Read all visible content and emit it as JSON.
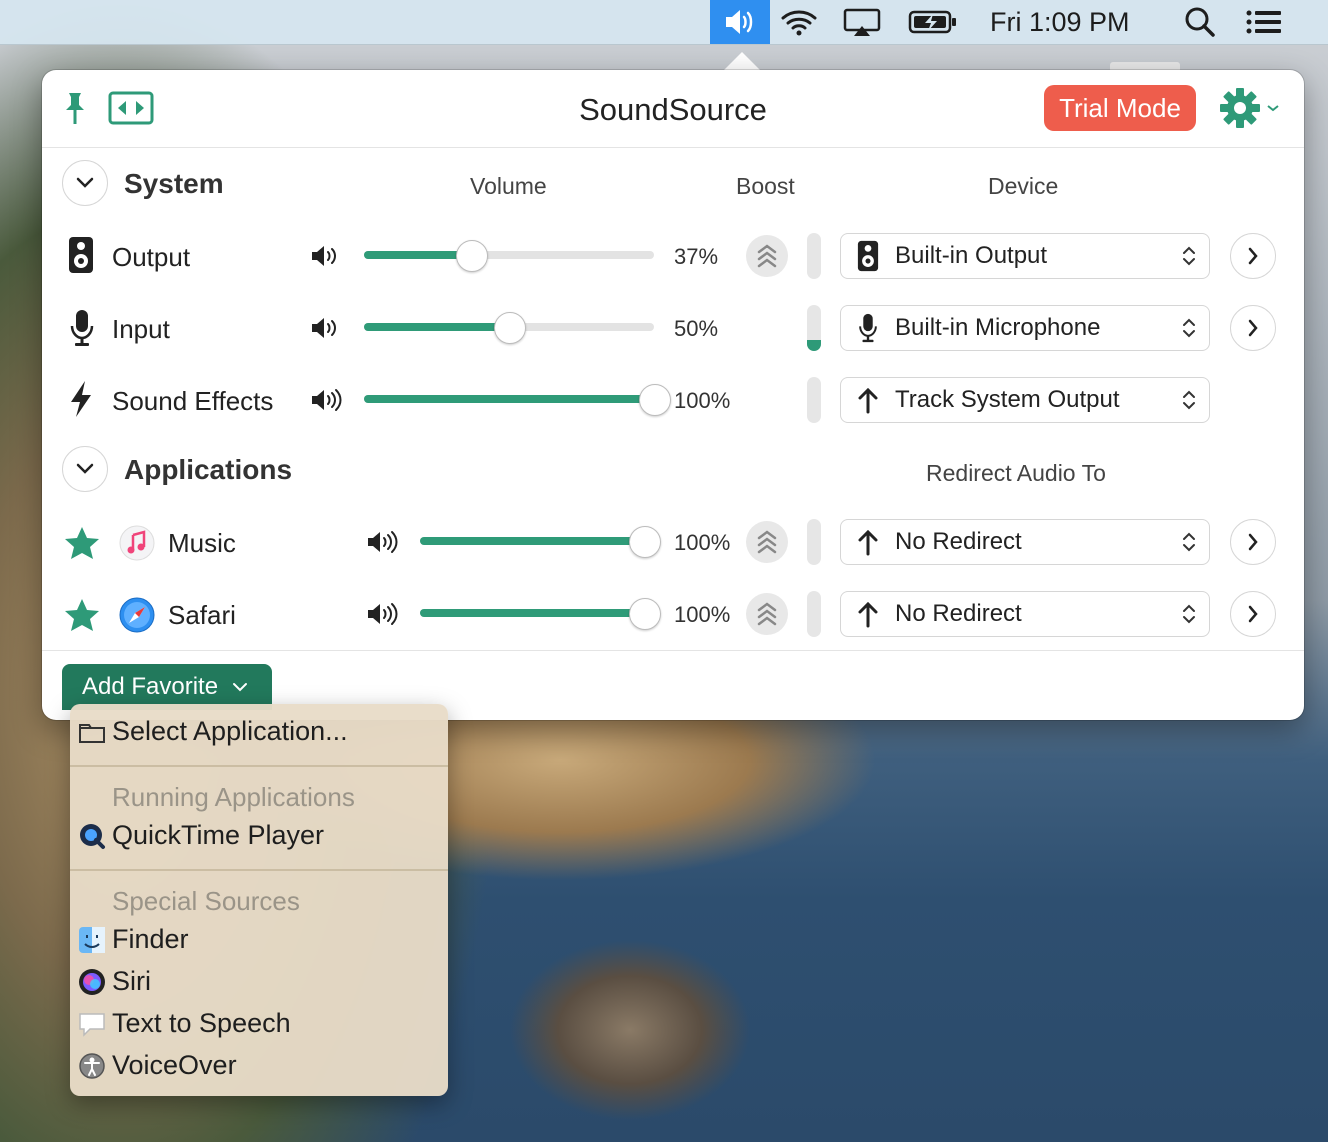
{
  "menubar": {
    "clock": "Fri 1:09 PM",
    "icons": [
      "sound-icon",
      "wifi-icon",
      "airplay-icon",
      "battery-charging-icon",
      "spotlight-search-icon",
      "control-center-icon"
    ]
  },
  "panel": {
    "title": "SoundSource",
    "trial_label": "Trial Mode",
    "accent_color": "#2e9a78",
    "trial_color": "#ee5d4c"
  },
  "system": {
    "title": "System",
    "col_volume": "Volume",
    "col_boost": "Boost",
    "col_device": "Device",
    "rows": [
      {
        "label": "Output",
        "volume": 37,
        "pct": "37%",
        "device": "Built-in Output",
        "meter": 0
      },
      {
        "label": "Input",
        "volume": 50,
        "pct": "50%",
        "device": "Built-in Microphone",
        "meter": 0.25
      },
      {
        "label": "Sound Effects",
        "volume": 100,
        "pct": "100%",
        "device": "Track System Output",
        "meter": 0
      }
    ]
  },
  "applications": {
    "title": "Applications",
    "col_redirect": "Redirect Audio To",
    "rows": [
      {
        "label": "Music",
        "volume": 100,
        "pct": "100%",
        "redirect": "No Redirect",
        "favorite": true
      },
      {
        "label": "Safari",
        "volume": 100,
        "pct": "100%",
        "redirect": "No Redirect",
        "favorite": true
      }
    ]
  },
  "add_favorite": {
    "label": "Add Favorite"
  },
  "menu": {
    "select_app": "Select Application...",
    "running_header": "Running Applications",
    "running": [
      "QuickTime Player"
    ],
    "special_header": "Special Sources",
    "special": [
      "Finder",
      "Siri",
      "Text to Speech",
      "VoiceOver"
    ]
  }
}
